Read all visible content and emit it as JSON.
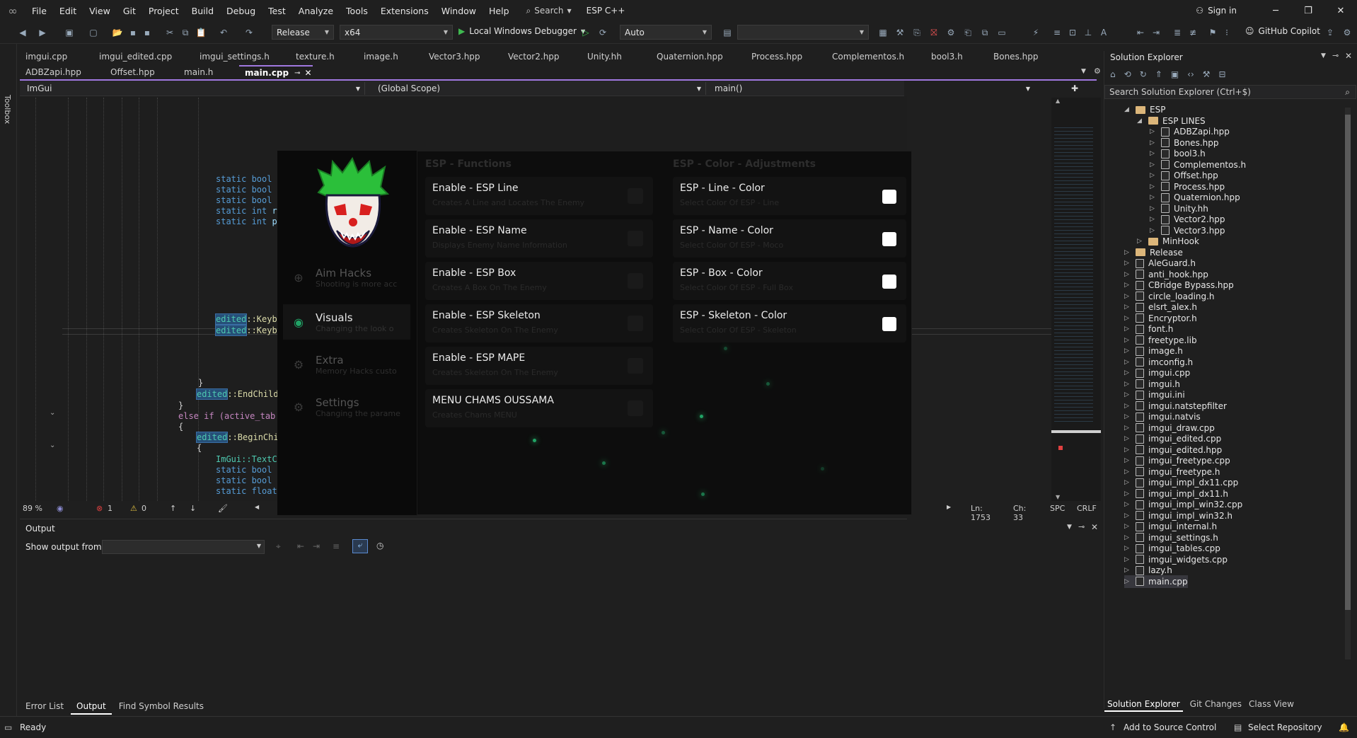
{
  "menubar": {
    "items": [
      "File",
      "Edit",
      "View",
      "Git",
      "Project",
      "Build",
      "Debug",
      "Test",
      "Analyze",
      "Tools",
      "Extensions",
      "Window",
      "Help"
    ],
    "search_label": "Search",
    "project_name": "ESP C++",
    "sign_in": "Sign in"
  },
  "toolbar": {
    "config": "Release",
    "platform": "x64",
    "debugger": "Local Windows Debugger",
    "auto": "Auto",
    "copilot": "GitHub Copilot"
  },
  "toolbox_label": "Toolbox",
  "tabs_row1": [
    "imgui.cpp",
    "imgui_edited.cpp",
    "imgui_settings.h",
    "texture.h",
    "image.h",
    "Vector3.hpp",
    "Vector2.hpp",
    "Unity.hh",
    "Quaternion.hpp",
    "Process.hpp",
    "Complementos.h",
    "bool3.h",
    "Bones.hpp"
  ],
  "tabs_row2": [
    "ADBZapi.hpp",
    "Offset.hpp",
    "main.h"
  ],
  "active_tab": "main.cpp",
  "navbar": {
    "project": "ImGui",
    "scope": "(Global Scope)",
    "function": "main()"
  },
  "code": {
    "static_bool": "static bool",
    "static_int": "static int",
    "static_float": "static float",
    "frag_e": "e",
    "frag_p": "p",
    "frag_c": "c",
    "frag_re": "re",
    "frag_pr": "pr",
    "edited": "edited",
    "keybi": "::Keybi",
    "close_brace": "}",
    "open_brace": "{",
    "endchild": "::EndChild(",
    "else_if": "else if (active_tab =",
    "beginchild": "::BeginChil",
    "textc": "ImGui::TextC"
  },
  "status": {
    "zoom": "89 %",
    "errors": "1",
    "warnings": "0",
    "line": "Ln: 1753",
    "col": "Ch: 33",
    "spc": "SPC",
    "crlf": "CRLF"
  },
  "output": {
    "title": "Output",
    "show_from": "Show output from:"
  },
  "bottom_tabs": [
    "Error List",
    "Output",
    "Find Symbol Results"
  ],
  "solution": {
    "title": "Solution Explorer",
    "search_placeholder": "Search Solution Explorer (Ctrl+$)",
    "items": [
      {
        "label": "ESP",
        "type": "folder"
      },
      {
        "label": "ESP LINES",
        "type": "folder"
      },
      {
        "label": "ADBZapi.hpp",
        "type": "file"
      },
      {
        "label": "Bones.hpp",
        "type": "file"
      },
      {
        "label": "bool3.h",
        "type": "file"
      },
      {
        "label": "Complementos.h",
        "type": "file"
      },
      {
        "label": "Offset.hpp",
        "type": "file"
      },
      {
        "label": "Process.hpp",
        "type": "file"
      },
      {
        "label": "Quaternion.hpp",
        "type": "file"
      },
      {
        "label": "Unity.hh",
        "type": "file"
      },
      {
        "label": "Vector2.hpp",
        "type": "file"
      },
      {
        "label": "Vector3.hpp",
        "type": "file"
      },
      {
        "label": "MinHook",
        "type": "folder"
      },
      {
        "label": "Release",
        "type": "folder"
      },
      {
        "label": "AleGuard.h",
        "type": "file"
      },
      {
        "label": "anti_hook.hpp",
        "type": "file"
      },
      {
        "label": "CBridge Bypass.hpp",
        "type": "file"
      },
      {
        "label": "circle_loading.h",
        "type": "file"
      },
      {
        "label": "elsrt_alex.h",
        "type": "file"
      },
      {
        "label": "Encryptor.h",
        "type": "file"
      },
      {
        "label": "font.h",
        "type": "file"
      },
      {
        "label": "freetype.lib",
        "type": "file"
      },
      {
        "label": "image.h",
        "type": "file"
      },
      {
        "label": "imconfig.h",
        "type": "file"
      },
      {
        "label": "imgui.cpp",
        "type": "file"
      },
      {
        "label": "imgui.h",
        "type": "file"
      },
      {
        "label": "imgui.ini",
        "type": "file"
      },
      {
        "label": "imgui.natstepfilter",
        "type": "file"
      },
      {
        "label": "imgui.natvis",
        "type": "file"
      },
      {
        "label": "imgui_draw.cpp",
        "type": "file"
      },
      {
        "label": "imgui_edited.cpp",
        "type": "file"
      },
      {
        "label": "imgui_edited.hpp",
        "type": "file"
      },
      {
        "label": "imgui_freetype.cpp",
        "type": "file"
      },
      {
        "label": "imgui_freetype.h",
        "type": "file"
      },
      {
        "label": "imgui_impl_dx11.cpp",
        "type": "file"
      },
      {
        "label": "imgui_impl_dx11.h",
        "type": "file"
      },
      {
        "label": "imgui_impl_win32.cpp",
        "type": "file"
      },
      {
        "label": "imgui_impl_win32.h",
        "type": "file"
      },
      {
        "label": "imgui_internal.h",
        "type": "file"
      },
      {
        "label": "imgui_settings.h",
        "type": "file"
      },
      {
        "label": "imgui_tables.cpp",
        "type": "file"
      },
      {
        "label": "imgui_widgets.cpp",
        "type": "file"
      },
      {
        "label": "lazy.h",
        "type": "file"
      },
      {
        "label": "main.cpp",
        "type": "file"
      }
    ],
    "tabs": [
      "Solution Explorer",
      "Git Changes",
      "Class View"
    ]
  },
  "statusbar": {
    "ready": "Ready",
    "source_control": "Add to Source Control",
    "repo": "Select Repository"
  },
  "overlay": {
    "nav": [
      {
        "title": "Aim Hacks",
        "sub": "Shooting is more acc",
        "icon": "crosshair-icon"
      },
      {
        "title": "Visuals",
        "sub": "Changing the look o",
        "icon": "eye-icon",
        "active": true
      },
      {
        "title": "Extra",
        "sub": "Memory Hacks custo",
        "icon": "gear-icon"
      },
      {
        "title": "Settings",
        "sub": "Changing the parame",
        "icon": "gear-icon"
      }
    ],
    "functions_title": "ESP - Functions",
    "colors_title": "ESP - Color - Adjustments",
    "functions": [
      {
        "title": "Enable - ESP Line",
        "sub": "Creates A Line and Locates The Enemy"
      },
      {
        "title": "Enable - ESP Name",
        "sub": "Displays Enemy Name Information"
      },
      {
        "title": "Enable - ESP Box",
        "sub": "Creates A Box On The Enemy"
      },
      {
        "title": "Enable - ESP Skeleton",
        "sub": "Creates Skeleton On The Enemy"
      },
      {
        "title": "Enable - ESP MAPE",
        "sub": "Creates Skeleton On The Enemy"
      },
      {
        "title": "MENU CHAMS OUSSAMA",
        "sub": "Creates Chams MENU"
      }
    ],
    "colors": [
      {
        "title": "ESP - Line - Color",
        "sub": "Select Color Of ESP - Line"
      },
      {
        "title": "ESP - Name - Color",
        "sub": "Select Color Of ESP - Moco"
      },
      {
        "title": "ESP - Box - Color",
        "sub": "Select Color Of ESP - Full Box"
      },
      {
        "title": "ESP - Skeleton - Color",
        "sub": "Select Color Of ESP - Skeleton"
      }
    ]
  },
  "colors": {
    "accent": "#a078e0",
    "particle": "#21a366"
  }
}
